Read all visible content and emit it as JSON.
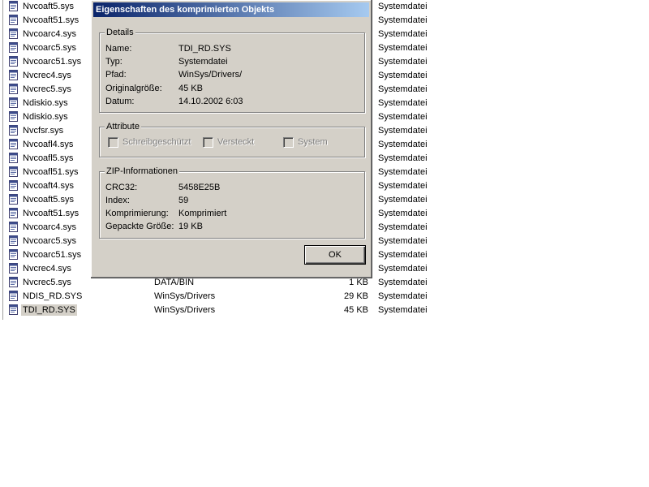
{
  "file_rows": [
    {
      "name": "Nvcoaft5.sys",
      "path": "",
      "size": "",
      "type": "Systemdatei"
    },
    {
      "name": "Nvcoaft51.sys",
      "path": "",
      "size": "",
      "type": "Systemdatei"
    },
    {
      "name": "Nvcoarc4.sys",
      "path": "",
      "size": "",
      "type": "Systemdatei"
    },
    {
      "name": "Nvcoarc5.sys",
      "path": "",
      "size": "",
      "type": "Systemdatei"
    },
    {
      "name": "Nvcoarc51.sys",
      "path": "",
      "size": "",
      "type": "Systemdatei"
    },
    {
      "name": "Nvcrec4.sys",
      "path": "",
      "size": "",
      "type": "Systemdatei"
    },
    {
      "name": "Nvcrec5.sys",
      "path": "",
      "size": "",
      "type": "Systemdatei"
    },
    {
      "name": "Ndiskio.sys",
      "path": "",
      "size": "",
      "type": "Systemdatei"
    },
    {
      "name": "Ndiskio.sys",
      "path": "",
      "size": "",
      "type": "Systemdatei"
    },
    {
      "name": "Nvcfsr.sys",
      "path": "",
      "size": "",
      "type": "Systemdatei"
    },
    {
      "name": "Nvcoafl4.sys",
      "path": "",
      "size": "",
      "type": "Systemdatei"
    },
    {
      "name": "Nvcoafl5.sys",
      "path": "",
      "size": "",
      "type": "Systemdatei"
    },
    {
      "name": "Nvcoafl51.sys",
      "path": "",
      "size": "",
      "type": "Systemdatei"
    },
    {
      "name": "Nvcoaft4.sys",
      "path": "",
      "size": "",
      "type": "Systemdatei"
    },
    {
      "name": "Nvcoaft5.sys",
      "path": "",
      "size": "",
      "type": "Systemdatei"
    },
    {
      "name": "Nvcoaft51.sys",
      "path": "",
      "size": "",
      "type": "Systemdatei"
    },
    {
      "name": "Nvcoarc4.sys",
      "path": "",
      "size": "",
      "type": "Systemdatei"
    },
    {
      "name": "Nvcoarc5.sys",
      "path": "",
      "size": "",
      "type": "Systemdatei"
    },
    {
      "name": "Nvcoarc51.sys",
      "path": "",
      "size": "",
      "type": "Systemdatei"
    },
    {
      "name": "Nvcrec4.sys",
      "path": "",
      "size": "",
      "type": "Systemdatei"
    },
    {
      "name": "Nvcrec5.sys",
      "path": "DATA/BIN",
      "size": "1 KB",
      "type": "Systemdatei"
    },
    {
      "name": "NDIS_RD.SYS",
      "path": "WinSys/Drivers",
      "size": "29 KB",
      "type": "Systemdatei"
    },
    {
      "name": "TDI_RD.SYS",
      "path": "WinSys/Drivers",
      "size": "45 KB",
      "type": "Systemdatei",
      "selected": true
    }
  ],
  "dialog": {
    "title": "Eigenschaften des komprimierten Objekts",
    "details": {
      "legend": "Details",
      "name_label": "Name:",
      "name_value": "TDI_RD.SYS",
      "type_label": "Typ:",
      "type_value": "Systemdatei",
      "path_label": "Pfad:",
      "path_value": "WinSys/Drivers/",
      "size_label": "Originalgröße:",
      "size_value": "45 KB",
      "date_label": "Datum:",
      "date_value": "14.10.2002 6:03"
    },
    "attributes": {
      "legend": "Attribute",
      "readonly_label": "Schreibgeschützt",
      "hidden_label": "Versteckt",
      "system_label": "System"
    },
    "zip": {
      "legend": "ZIP-Informationen",
      "crc_label": "CRC32:",
      "crc_value": "5458E25B",
      "index_label": "Index:",
      "index_value": "59",
      "compression_label": "Komprimierung:",
      "compression_value": "Komprimiert",
      "packed_label": "Gepackte Größe:",
      "packed_value": "19 KB"
    },
    "ok_label": "OK"
  }
}
